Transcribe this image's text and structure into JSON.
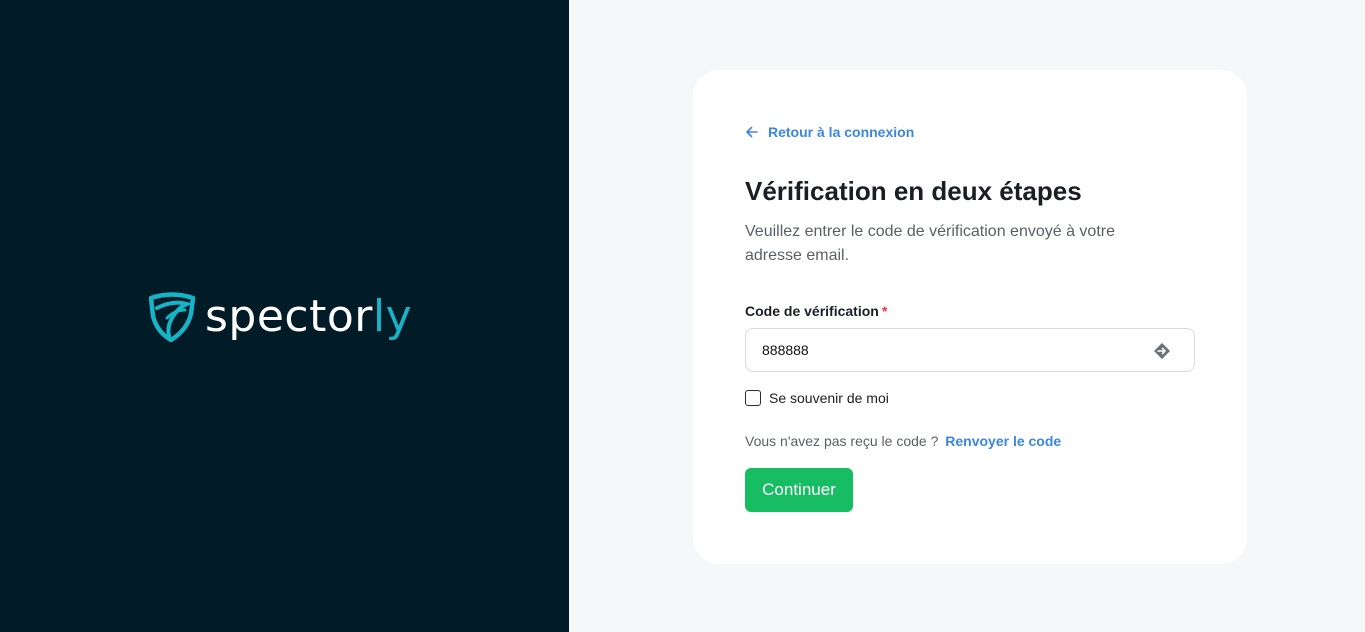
{
  "brand": {
    "name_main": "spector",
    "name_accent": "ly",
    "accent_color": "#17b4c8",
    "background_color": "#011b27"
  },
  "form": {
    "back_link_label": "Retour à la connexion",
    "title": "Vérification en deux étapes",
    "subtitle": "Veuillez entrer le code de vérification envoyé à votre adresse email.",
    "code_label": "Code de vérification",
    "required_marker": "*",
    "code_value": "888888",
    "remember_label": "Se souvenir de moi",
    "remember_checked": false,
    "resend_prompt": "Vous n'avez pas reçu le code ?",
    "resend_link": "Renvoyer le code",
    "submit_label": "Continuer",
    "submit_color": "#16bd63",
    "link_color": "#3b87e0",
    "icons": {
      "back": "arrow-left-icon",
      "input_action": "autofill-icon"
    }
  }
}
